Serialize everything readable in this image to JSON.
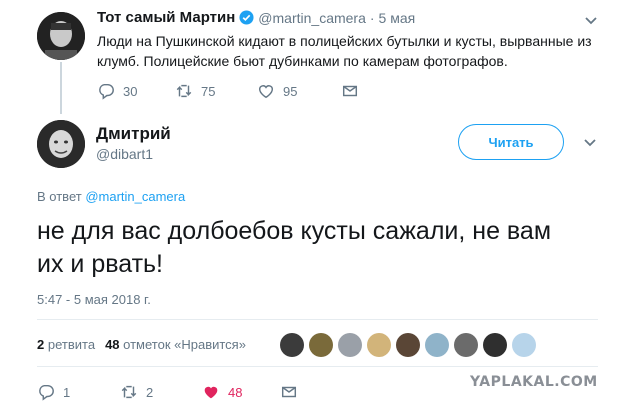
{
  "parent_tweet": {
    "display_name": "Тот самый Мартин",
    "handle": "@martin_camera",
    "separator": "·",
    "date": "5 мая",
    "text_line1": "Люди на Пушкинской кидают в полицейских бутылки и кусты, вырванные из",
    "text_line2": "клумб. Полицейские бьют дубинками по камерам фотографов.",
    "replies": "30",
    "retweets": "75",
    "likes": "95",
    "avatar_icon": "user-avatar-photo",
    "verified_icon": "verified-badge-icon",
    "verified_color": "#1da1f2"
  },
  "main_tweet": {
    "display_name": "Дмитрий",
    "handle": "@dibart1",
    "follow_label": "Читать",
    "reply_to_prefix": "В ответ",
    "reply_to_handle": "@martin_camera",
    "text_line1": "не для вас долбоебов кусты сажали, не вам",
    "text_line2": "их и рвать!",
    "timestamp": "5:47 - 5 мая 2018 г.",
    "retweets_count": "2",
    "retweets_label": "ретвита",
    "likes_count": "48",
    "likes_label": "отметок «Нравится»",
    "footer_replies": "1",
    "footer_retweets": "2",
    "footer_likes": "48",
    "like_color": "#e0245e",
    "accent_color": "#1da1f2"
  },
  "watermark": "YAPLAKAL.COM"
}
